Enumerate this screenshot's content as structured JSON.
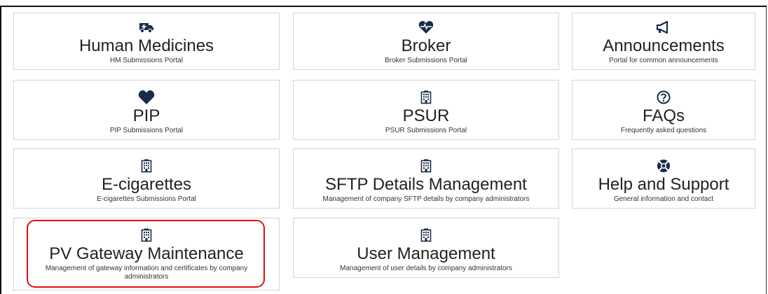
{
  "tiles": [
    {
      "icon": "ambulance-icon",
      "title": "Human Medicines",
      "subtitle": "HM Submissions Portal"
    },
    {
      "icon": "heartbeat-icon",
      "title": "Broker",
      "subtitle": "Broker Submissions Portal"
    },
    {
      "icon": "megaphone-icon",
      "title": "Announcements",
      "subtitle": "Portal for common announcements"
    },
    {
      "icon": "heart-icon",
      "title": "PIP",
      "subtitle": "PIP Submissions Portal"
    },
    {
      "icon": "building-icon",
      "title": "PSUR",
      "subtitle": "PSUR Submissions Portal"
    },
    {
      "icon": "question-circle-icon",
      "title": "FAQs",
      "subtitle": "Frequently asked questions"
    },
    {
      "icon": "building-icon",
      "title": "E-cigarettes",
      "subtitle": "E-cigarettes Submissions Portal"
    },
    {
      "icon": "building-icon",
      "title": "SFTP Details Management",
      "subtitle": "Management of company SFTP details by company administrators"
    },
    {
      "icon": "life-ring-icon",
      "title": "Help and Support",
      "subtitle": "General information and contact"
    },
    {
      "icon": "building-icon",
      "title": "PV Gateway Maintenance",
      "subtitle": "Management of gateway information and certificates by company administrators"
    },
    {
      "icon": "building-icon",
      "title": "User Management",
      "subtitle": "Management of user details by company administrators"
    }
  ],
  "colors": {
    "icon": "#1a2a4a",
    "highlight": "#e01010"
  }
}
